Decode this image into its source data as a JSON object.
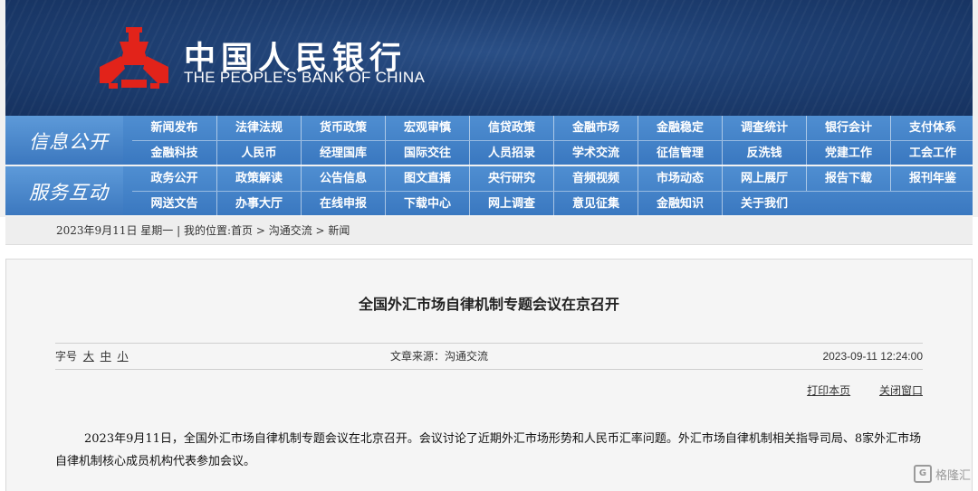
{
  "header": {
    "logo_cn": "中国人民银行",
    "logo_en": "THE PEOPLE'S BANK OF CHINA",
    "brand_red": "#e2231a",
    "banner_blue": "#1e3f72"
  },
  "nav": {
    "sections": [
      {
        "title": "信息公开",
        "rows": [
          [
            "新闻发布",
            "法律法规",
            "货币政策",
            "宏观审慎",
            "信贷政策",
            "金融市场",
            "金融稳定",
            "调查统计",
            "银行会计",
            "支付体系"
          ],
          [
            "金融科技",
            "人民币",
            "经理国库",
            "国际交往",
            "人员招录",
            "学术交流",
            "征信管理",
            "反洗钱",
            "党建工作",
            "工会工作"
          ]
        ]
      },
      {
        "title": "服务互动",
        "rows": [
          [
            "政务公开",
            "政策解读",
            "公告信息",
            "图文直播",
            "央行研究",
            "音频视频",
            "市场动态",
            "网上展厅",
            "报告下载",
            "报刊年鉴"
          ],
          [
            "网送文告",
            "办事大厅",
            "在线申报",
            "下载中心",
            "网上调查",
            "意见征集",
            "金融知识",
            "关于我们"
          ]
        ]
      }
    ],
    "color": "#3f7dc4"
  },
  "breadcrumb": {
    "date": "2023年9月11日 星期一",
    "sep": " | ",
    "prefix": "我的位置:",
    "home": "首页",
    "arrow1": " > ",
    "section": "沟通交流",
    "arrow2": " > ",
    "current": "新闻"
  },
  "article": {
    "title": "全国外汇市场自律机制专题会议在京召开",
    "font_size_label": "字号",
    "font_large": "大",
    "font_medium": "中",
    "font_small": "小",
    "source": "文章来源：沟通交流",
    "datetime": "2023-09-11 12:24:00",
    "print_label": "打印本页",
    "close_label": "关闭窗口",
    "paragraph": "2023年9月11日，全国外汇市场自律机制专题会议在北京召开。会议讨论了近期外汇市场形势和人民币汇率问题。外汇市场自律机制相关指导司局、8家外汇市场自律机制核心成员机构代表参加会议。"
  },
  "watermark": {
    "icon": "G",
    "text": "格隆汇"
  }
}
